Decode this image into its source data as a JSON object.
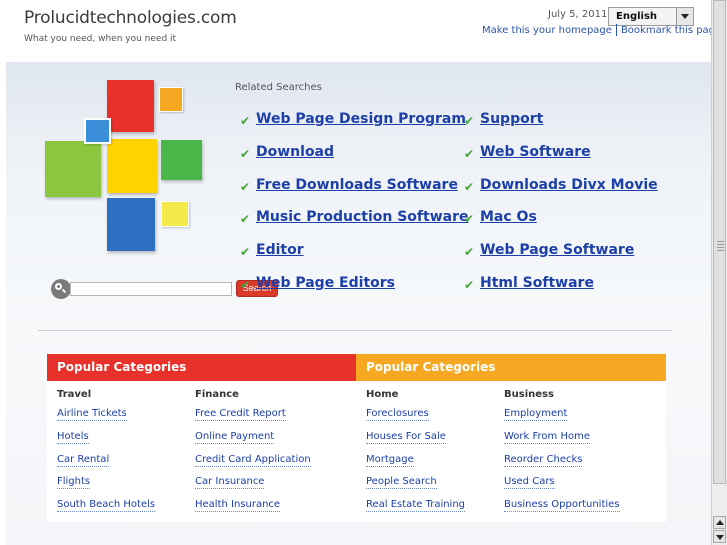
{
  "header": {
    "site_title": "Prolucidtechnologies.com",
    "tagline": "What you need, when you need it",
    "date": "July 5, 2011",
    "language": "English",
    "make_homepage": "Make this your homepage",
    "bookmark": "Bookmark this page"
  },
  "search": {
    "button_label": "Search",
    "value": ""
  },
  "related": {
    "title": "Related Searches",
    "left": [
      "Web Page Design Program",
      "Download",
      "Free Downloads Software",
      "Music Production Software",
      "Editor",
      "Web Page Editors"
    ],
    "right": [
      "Support",
      "Web Software",
      "Downloads Divx Movie",
      "Mac Os",
      "Web Page Software",
      "Html Software"
    ],
    "check_glyph": "✔"
  },
  "categories": [
    {
      "title": "Popular Categories",
      "color": "#e8312a",
      "columns": [
        {
          "title": "Travel",
          "links": [
            "Airline Tickets",
            "Hotels",
            "Car Rental",
            "Flights",
            "South Beach Hotels"
          ]
        },
        {
          "title": "Finance",
          "links": [
            "Free Credit Report",
            "Online Payment",
            "Credit Card Application",
            "Car Insurance",
            "Health Insurance"
          ]
        }
      ]
    },
    {
      "title": "Popular Categories",
      "color": "#f6a823",
      "columns": [
        {
          "title": "Home",
          "links": [
            "Foreclosures",
            "Houses For Sale",
            "Mortgage",
            "People Search",
            "Real Estate Training"
          ]
        },
        {
          "title": "Business",
          "links": [
            "Employment",
            "Work From Home",
            "Reorder Checks",
            "Used Cars",
            "Business Opportunities"
          ]
        }
      ]
    }
  ],
  "logo_colors": [
    "#e8312a",
    "#f6a823",
    "#3b8ed8",
    "#8cc63f",
    "#ffd200",
    "#4cb748",
    "#2f6fc1",
    "#f6e94a"
  ]
}
